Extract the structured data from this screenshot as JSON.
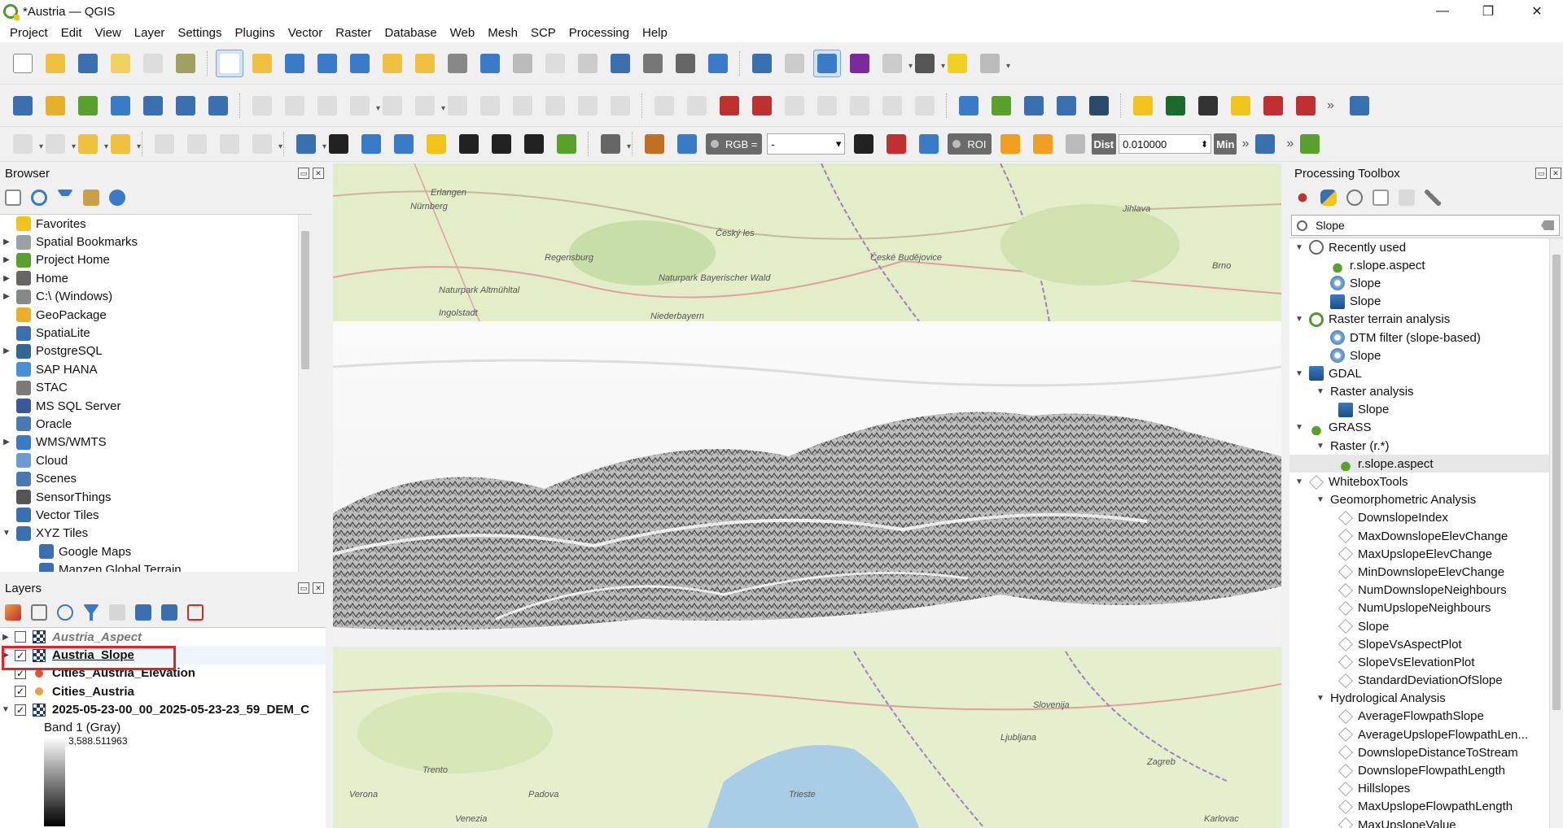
{
  "window": {
    "title": "*Austria — QGIS",
    "controls": [
      "—",
      "❐",
      "✕"
    ]
  },
  "menu": [
    "Project",
    "Edit",
    "View",
    "Layer",
    "Settings",
    "Plugins",
    "Vector",
    "Raster",
    "Database",
    "Web",
    "Mesh",
    "SCP",
    "Processing",
    "Help"
  ],
  "toolbar3": {
    "rgb_label": "RGB =",
    "rgb_select": "-",
    "roi_label": "ROI",
    "dist_label": "Dist",
    "dist_value": "0.010000",
    "min_label": "Min"
  },
  "browser": {
    "title": "Browser",
    "items": [
      {
        "label": "Favorites",
        "expandable": false,
        "icon": "star-icon",
        "color": "#f0c419"
      },
      {
        "label": "Spatial Bookmarks",
        "expandable": true,
        "icon": "bookmark-icon",
        "color": "#9aa0a6"
      },
      {
        "label": "Project Home",
        "expandable": true,
        "icon": "project-home-icon",
        "color": "#5aa02c"
      },
      {
        "label": "Home",
        "expandable": true,
        "icon": "home-icon",
        "color": "#666666"
      },
      {
        "label": "C:\\ (Windows)",
        "expandable": true,
        "icon": "drive-icon",
        "color": "#888888"
      },
      {
        "label": "GeoPackage",
        "expandable": false,
        "icon": "geopackage-icon",
        "color": "#e8b02a"
      },
      {
        "label": "SpatiaLite",
        "expandable": false,
        "icon": "spatialite-icon",
        "color": "#3a6fb0"
      },
      {
        "label": "PostgreSQL",
        "expandable": true,
        "icon": "postgresql-icon",
        "color": "#336791"
      },
      {
        "label": "SAP HANA",
        "expandable": false,
        "icon": "sap-hana-icon",
        "color": "#4a90d9"
      },
      {
        "label": "STAC",
        "expandable": false,
        "icon": "stac-icon",
        "color": "#7a7a7a"
      },
      {
        "label": "MS SQL Server",
        "expandable": false,
        "icon": "mssql-icon",
        "color": "#3b5998"
      },
      {
        "label": "Oracle",
        "expandable": false,
        "icon": "oracle-icon",
        "color": "#4a78b5"
      },
      {
        "label": "WMS/WMTS",
        "expandable": true,
        "icon": "wms-icon",
        "color": "#3a7bc8"
      },
      {
        "label": "Cloud",
        "expandable": false,
        "icon": "cloud-icon",
        "color": "#6c9bd2"
      },
      {
        "label": "Scenes",
        "expandable": false,
        "icon": "scenes-icon",
        "color": "#4a78b5"
      },
      {
        "label": "SensorThings",
        "expandable": false,
        "icon": "sensorthings-icon",
        "color": "#555555"
      },
      {
        "label": "Vector Tiles",
        "expandable": false,
        "icon": "vector-tiles-icon",
        "color": "#3a6fb0"
      },
      {
        "label": "XYZ Tiles",
        "expandable": "open",
        "icon": "xyz-tiles-icon",
        "color": "#3a6fb0"
      },
      {
        "label": "Google Maps",
        "expandable": false,
        "icon": "tile-layer-icon",
        "color": "#3a6fb0",
        "indent": 1
      },
      {
        "label": "Mapzen Global Terrain",
        "expandable": false,
        "icon": "tile-layer-icon",
        "color": "#3a6fb0",
        "indent": 1
      }
    ]
  },
  "layers": {
    "title": "Layers",
    "items": [
      {
        "label": "Austria_Aspect",
        "checked": false,
        "type": "raster",
        "italic": true,
        "dim": true,
        "expandable": true
      },
      {
        "label": "Austria_Slope",
        "checked": true,
        "type": "raster",
        "underline": true,
        "expandable": true,
        "highlight": true
      },
      {
        "label": "Cities_Austria_Elevation",
        "checked": true,
        "type": "point",
        "color": "#e0553a"
      },
      {
        "label": "Cities_Austria",
        "checked": true,
        "type": "point",
        "color": "#e8a040"
      },
      {
        "label": "2025-05-23-00_00_2025-05-23-23_59_DEM_C",
        "checked": true,
        "type": "raster",
        "expandable": "open"
      }
    ],
    "band_label": "Band 1 (Gray)",
    "legend_max": "3,588.511963"
  },
  "toolbox": {
    "title": "Processing Toolbox",
    "search_value": "Slope",
    "items": [
      {
        "label": "Recently used",
        "level": 0,
        "arrow": "open",
        "icon": "clock"
      },
      {
        "label": "r.slope.aspect",
        "level": 1,
        "icon": "grass"
      },
      {
        "label": "Slope",
        "level": 1,
        "icon": "gear"
      },
      {
        "label": "Slope",
        "level": 1,
        "icon": "gdal"
      },
      {
        "label": "Raster terrain analysis",
        "level": 0,
        "arrow": "open",
        "icon": "qgis"
      },
      {
        "label": "DTM filter (slope-based)",
        "level": 1,
        "icon": "gear"
      },
      {
        "label": "Slope",
        "level": 1,
        "icon": "gear"
      },
      {
        "label": "GDAL",
        "level": 0,
        "arrow": "open",
        "icon": "gdal"
      },
      {
        "label": "Raster analysis",
        "level": 1,
        "arrow": "open",
        "icon": "none"
      },
      {
        "label": "Slope",
        "level": 2,
        "icon": "gdal"
      },
      {
        "label": "GRASS",
        "level": 0,
        "arrow": "open",
        "icon": "grass"
      },
      {
        "label": "Raster (r.*)",
        "level": 1,
        "arrow": "open",
        "icon": "none"
      },
      {
        "label": "r.slope.aspect",
        "level": 2,
        "icon": "grass",
        "selected": true
      },
      {
        "label": "WhiteboxTools",
        "level": 0,
        "arrow": "open",
        "icon": "cube"
      },
      {
        "label": "Geomorphometric Analysis",
        "level": 1,
        "arrow": "open",
        "icon": "none"
      },
      {
        "label": "DownslopeIndex",
        "level": 2,
        "icon": "cube"
      },
      {
        "label": "MaxDownslopeElevChange",
        "level": 2,
        "icon": "cube"
      },
      {
        "label": "MaxUpslopeElevChange",
        "level": 2,
        "icon": "cube"
      },
      {
        "label": "MinDownslopeElevChange",
        "level": 2,
        "icon": "cube"
      },
      {
        "label": "NumDownslopeNeighbours",
        "level": 2,
        "icon": "cube"
      },
      {
        "label": "NumUpslopeNeighbours",
        "level": 2,
        "icon": "cube"
      },
      {
        "label": "Slope",
        "level": 2,
        "icon": "cube"
      },
      {
        "label": "SlopeVsAspectPlot",
        "level": 2,
        "icon": "cube"
      },
      {
        "label": "SlopeVsElevationPlot",
        "level": 2,
        "icon": "cube"
      },
      {
        "label": "StandardDeviationOfSlope",
        "level": 2,
        "icon": "cube"
      },
      {
        "label": "Hydrological Analysis",
        "level": 1,
        "arrow": "open",
        "icon": "none"
      },
      {
        "label": "AverageFlowpathSlope",
        "level": 2,
        "icon": "cube"
      },
      {
        "label": "AverageUpslopeFlowpathLen...",
        "level": 2,
        "icon": "cube"
      },
      {
        "label": "DownslopeDistanceToStream",
        "level": 2,
        "icon": "cube"
      },
      {
        "label": "DownslopeFlowpathLength",
        "level": 2,
        "icon": "cube"
      },
      {
        "label": "Hillslopes",
        "level": 2,
        "icon": "cube"
      },
      {
        "label": "MaxUpslopeFlowpathLength",
        "level": 2,
        "icon": "cube"
      },
      {
        "label": "MaxUpslopeValue",
        "level": 2,
        "icon": "cube"
      }
    ]
  },
  "map": {
    "labels": [
      {
        "text": "Erlangen"
      },
      {
        "text": "Nürnberg"
      },
      {
        "text": "Regensburg"
      },
      {
        "text": "Ingolstadt"
      },
      {
        "text": "Naturpark Altmühltal"
      },
      {
        "text": "Naturpark Bayerischer Wald"
      },
      {
        "text": "Český les"
      },
      {
        "text": "České Budějovice"
      },
      {
        "text": "Jihlava"
      },
      {
        "text": "Brno"
      },
      {
        "text": "Niederbayern"
      },
      {
        "text": "Slovenija"
      },
      {
        "text": "Ljubljana"
      },
      {
        "text": "Trento"
      },
      {
        "text": "Trieste"
      },
      {
        "text": "Zagreb"
      },
      {
        "text": "Venezia"
      },
      {
        "text": "Verona"
      },
      {
        "text": "Padova"
      },
      {
        "text": "Karlovac"
      }
    ]
  }
}
